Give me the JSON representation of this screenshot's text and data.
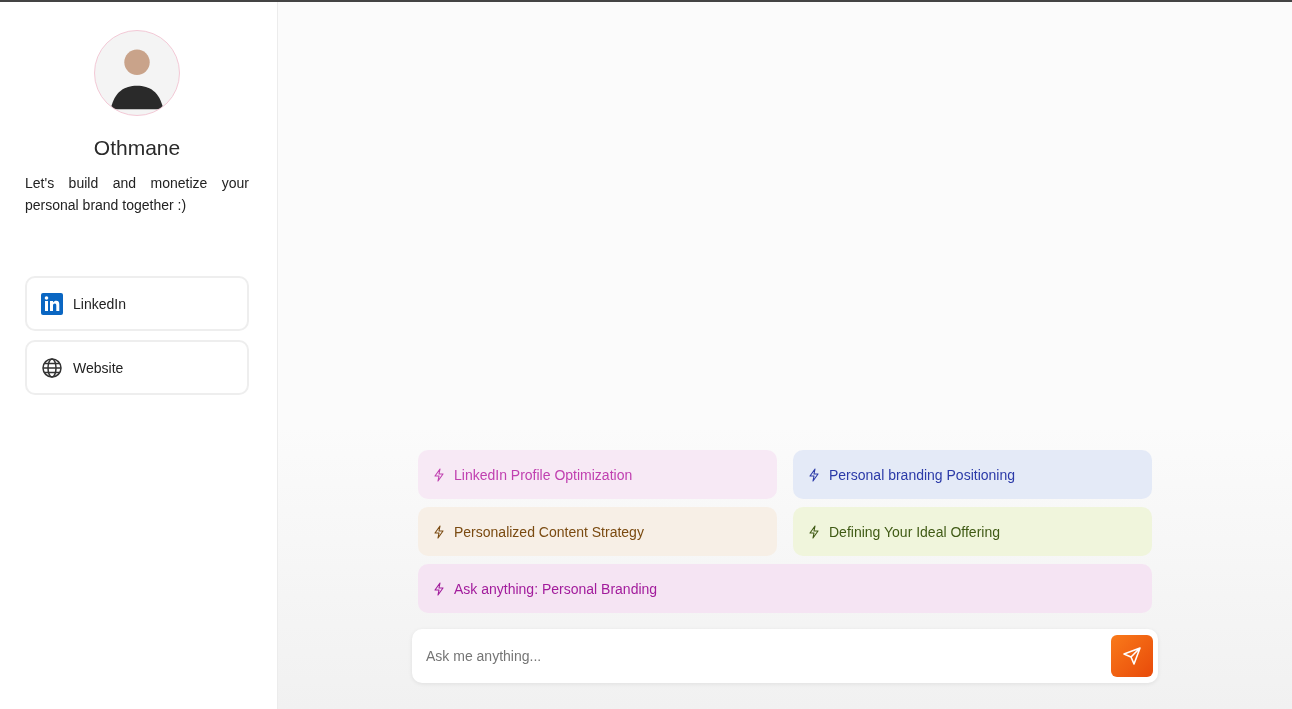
{
  "profile": {
    "name": "Othmane",
    "bio": "Let's build and monetize your personal brand together :)"
  },
  "links": [
    {
      "kind": "linkedin",
      "label": "LinkedIn"
    },
    {
      "kind": "website",
      "label": "Website"
    }
  ],
  "suggestions": [
    {
      "label": "LinkedIn Profile Optimization",
      "color": "#c040b0"
    },
    {
      "label": "Personal branding Positioning",
      "color": "#2b3aa8"
    },
    {
      "label": "Personalized Content Strategy",
      "color": "#7a4a10"
    },
    {
      "label": "Defining Your Ideal Offering",
      "color": "#3f5a14"
    },
    {
      "label": "Ask anything: Personal Branding",
      "color": "#a21c9c"
    }
  ],
  "chat_input": {
    "placeholder": "Ask me anything..."
  }
}
